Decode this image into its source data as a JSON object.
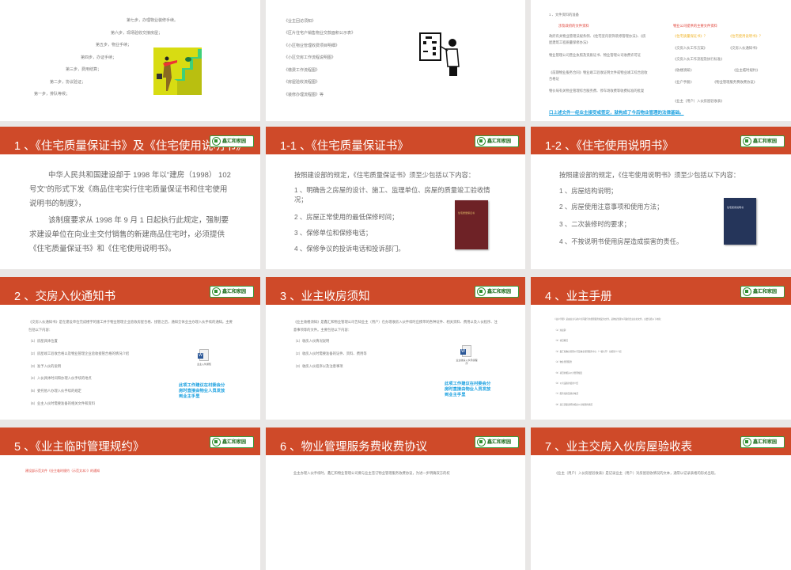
{
  "colors": {
    "header": "#cf4a29",
    "accent_blue": "#1aa0e0",
    "background": "#e9e7e6"
  },
  "logo_text": "鑫汇和家园",
  "slides": [
    {
      "steps": [
        "第七步，办理物业装修手续。",
        "第六步，现场验收交接房屋；",
        "第五步，物业手续；",
        "第四步，办证手续；",
        "第三步，费用结算；",
        "第二步，协议验证；",
        "第一步，排队等候；"
      ]
    },
    {
      "items": [
        "《业主回访须知》",
        "《区片住宅户销售物业交款面积公示表》",
        "《小区物业管理收费项目明细》",
        "《小区交房工作流程说明图》",
        "《缴费工作流程图》",
        "《房屋验收流程图》",
        "《装修办理流程图》等"
      ]
    },
    {
      "heading": "1 、文件资料的准备",
      "left_title": "涉及政府的文件资料",
      "left_items": [
        "政府有关物业管理法规条例、《住宅室内装饰装修管理办法》、《房屋建筑工程质量保修办法》",
        "物业管理公司营业执照及资质证书、物业管理公司收费许可证",
        "《前期物业服务合同》物业竣工验收证明文件或物业竣工综合验收合格证",
        "物价局有关物业管理综合服务费、停车场收费等收费标准的批复"
      ],
      "right_title": "物业公司提供的主要文件资料",
      "right_items": [
        "《住宅质量保证书》？",
        "《住宅使用说明书》？",
        "《交房入伙工作方案》",
        "《交房入伙通知书》",
        "《交房入伙工作流程及执行标准》",
        "《收楼须知》",
        "《业主临时规约》",
        "《业户手册》",
        "《物业管理服务费收费协议》",
        "《业主（用户）入伙房屋验收表》"
      ],
      "footer": "口上述文件一经业主接受或签定，就构成了今后物业管理的法律基础。"
    },
    {
      "title": "1 、《住宅质量保证书》及《住宅使用说明书》",
      "p1": "中华人民共和国建设部于 1998 年以\"建房（1998） 102 号文\"的形式下发《商品住宅实行住宅质量保证书和住宅使用说明书的制度》，",
      "p2": "该制度要求从 1998 年 9 月 1 日起执行此规定，强制要求建设单位在向业主交付销售的新建商品住宅时，必须提供《住宅质量保证书》和《住宅使用说明书》。"
    },
    {
      "title": "1-1 、《住宅质量保证书》",
      "intro": "按照建设部的规定，《住宅质量保证书》须至少包括以下内容：",
      "items": [
        "1 、明确告之房屋的设计、施工、监理单位、房屋的质量竣工验收情况；",
        "2 、房屋正常使用的最低保修时间；",
        "3 、保修单位和保修电话；",
        "4 、保修争议的投诉电话和投诉部门。"
      ],
      "book_title": "住宅质量保证书"
    },
    {
      "title": "1-2 、《住宅使用说明书》",
      "intro": "按照建设部的规定，《住宅使用说明书》须至少包括以下内容：",
      "items": [
        "1 、房屋结构说明；",
        "2 、房屋使用注意事项和使用方法；",
        "3 、二次装修时的要求；",
        "4 、不按说明书使用房屋造成损害的责任。"
      ],
      "book_title": "住宅使用说明书"
    },
    {
      "title": "2 、交房入伙通知书",
      "intro": "《交房入伙通知书》是在建设单位完成楼宇的施工并于物业管理企业验收房屋合格、接管之后，通知全体业主办理入伙手续的通知。主要包括以下内容：",
      "items": [
        "（1）房屋具体位置",
        "（2）房屋竣工验收合格以及物业管理企业验收接管合格的情况介绍",
        "（3）准予入伙的说明",
        "（4）入伙具体时间和办理入伙手续的地点",
        "（5）委托他人办理入伙手续的规定",
        "（6）业主入伙时需要准备的相关文件和资料"
      ],
      "file_label": "业主入伙通知",
      "note": "此项工作建议在村委会分房时直接由物业人员发放到业主手里"
    },
    {
      "title": "3 、业主收房须知",
      "intro": "《业主收楼须知》是鑫汇和物业管理公司告知业主（用户）在办理收房入伙手续时应携带的各种证件、相关资料、费用以及入伙程序、注意事项等的文件。主要包括以下内容：",
      "items": [
        "（1）收房入伙情况说明",
        "（2）收房入伙时需要准备的证件、资料、费用等",
        "（3）收房入伙程序以及注意事项"
      ],
      "file_label": "业主收房入伙手续程序",
      "note": "此项工作建议在村委会分房时直接由物业人员发放到业主手里"
    },
    {
      "title": "4 、业主手册",
      "intro": "《业户手册》是由业主与用户共同遵守的管理服务规定的文件，是物业管理公司提供给业主的文件，主要包括以下内容：",
      "items": [
        "（1）欢迎辞",
        "（2）项目概况",
        "（3）鑫汇和物业管理公司及物业管理服务中心（一楼大厅）功能简介介绍",
        "（4）物业管理服务",
        "（5）项目的相关公共管理规定",
        "（6）公共设施的使用介绍",
        "（7）服务指南及联系电话",
        "（8）其它需要说明的相关公共规则的情况"
      ]
    },
    {
      "title": "5 、《业主临时管理规约》",
      "body": "建设部示范文件《业主临时规约（示范文本）》的通知"
    },
    {
      "title": "6 、物业管理服务费收费协议",
      "body": "业主办理入伙手续时，鑫汇和物业管理公司要与业主签订物业管理服务收费协议，为进一步明确双方的权"
    },
    {
      "title": "7 、业主交房入伙房屋验收表",
      "body": "《业主（用户）入伙房屋验收表》是记录业主（用户）对房屋验收情况的文本，通常以记录表格的形式出现。"
    }
  ]
}
